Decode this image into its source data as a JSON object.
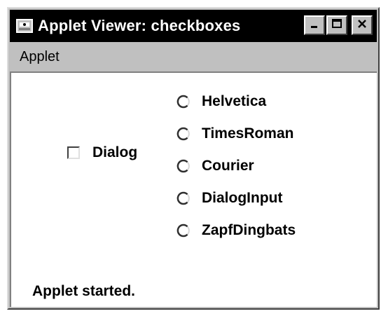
{
  "window": {
    "title": "Applet Viewer: checkboxes",
    "icon": "applet-icon",
    "controls": {
      "minimize_icon": "minimize-icon",
      "maximize_icon": "maximize-icon",
      "close_icon": "close-icon"
    }
  },
  "menubar": {
    "items": [
      {
        "label": "Applet"
      }
    ]
  },
  "main": {
    "checkbox": {
      "label": "Dialog",
      "checked": false
    },
    "radio_options": [
      {
        "label": "Helvetica",
        "selected": false
      },
      {
        "label": "TimesRoman",
        "selected": false
      },
      {
        "label": "Courier",
        "selected": false
      },
      {
        "label": "DialogInput",
        "selected": false
      },
      {
        "label": "ZapfDingbats",
        "selected": false
      }
    ]
  },
  "status_bar": {
    "text": "Applet started."
  },
  "colors": {
    "titlebar": "#000000",
    "chrome": "#c0c0c0",
    "content": "#ffffff"
  }
}
